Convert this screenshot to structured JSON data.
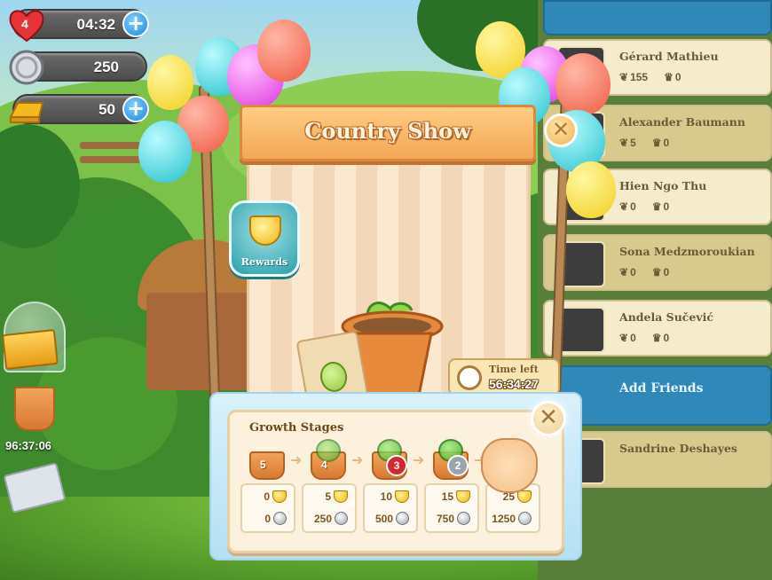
{
  "hud": {
    "lives": "4",
    "lives_timer": "04:32",
    "coins": "250",
    "gold": "50",
    "plus_symbol": "+"
  },
  "stand": {
    "title": "Country Show",
    "close_symbol": "✕",
    "rewards_label": "Rewards",
    "time_left_label": "Time left",
    "time_left_value": "56:34:27"
  },
  "side": {
    "timer": "96:37:06"
  },
  "growth": {
    "title": "Growth Stages",
    "close_symbol": "✕",
    "stages": [
      {
        "number": "5",
        "trophies": "0",
        "coins": "0"
      },
      {
        "number": "4",
        "trophies": "5",
        "coins": "250"
      },
      {
        "number": "3",
        "trophies": "10",
        "coins": "500"
      },
      {
        "number": "2",
        "trophies": "15",
        "coins": "750"
      },
      {
        "number": "",
        "trophies": "25",
        "coins": "1250"
      }
    ]
  },
  "friends": [
    {
      "name": "Gérard Mathieu",
      "seeds": "155",
      "trophies": "0"
    },
    {
      "name": "Alexander Baumann",
      "seeds": "5",
      "trophies": "0"
    },
    {
      "name": "Hien Ngo Thu",
      "seeds": "0",
      "trophies": "0"
    },
    {
      "name": "Sona Medzmoroukian",
      "seeds": "0",
      "trophies": "0"
    },
    {
      "name": "Andela Sučević",
      "seeds": "0",
      "trophies": "0"
    },
    {
      "name": "Sandrine Deshayes",
      "seeds": "",
      "trophies": ""
    }
  ],
  "add_friends_label": "Add Friends",
  "colors": {
    "banner": "#f3a656",
    "panel": "#fbf1dc",
    "accent_blue": "#1e86e0",
    "friend_card": "#f4eccc"
  }
}
